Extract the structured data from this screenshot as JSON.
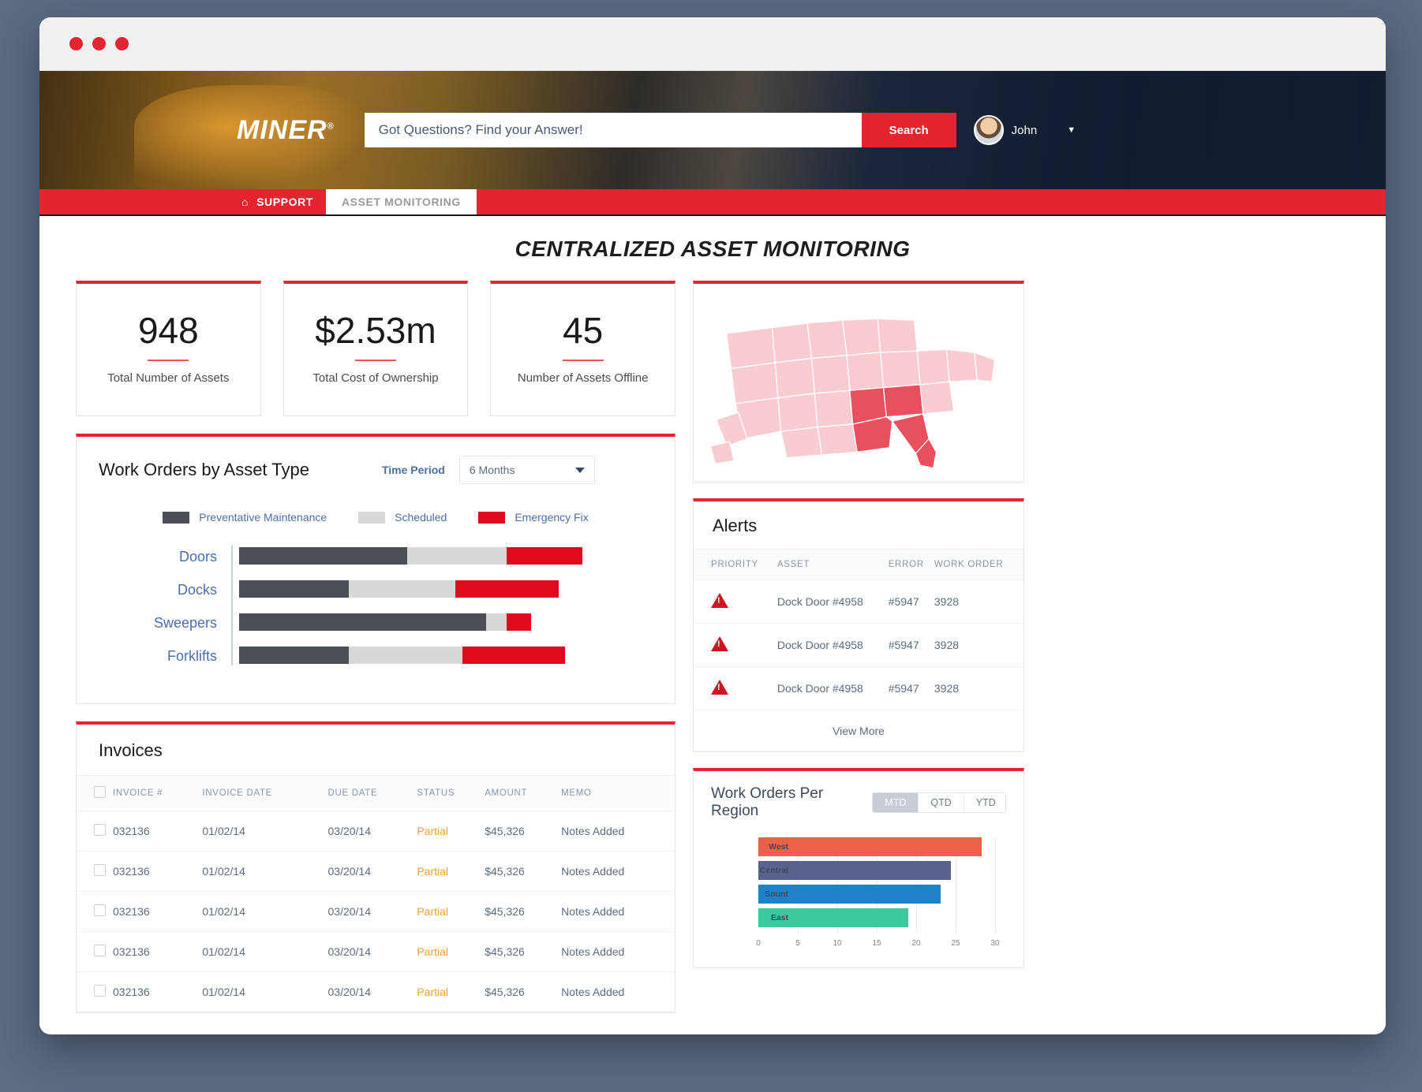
{
  "header": {
    "logo": "MINER",
    "search": {
      "placeholder": "Got Questions? Find your Answer!",
      "value": "",
      "button": "Search"
    },
    "user": {
      "name": "John"
    }
  },
  "nav": {
    "support": "SUPPORT",
    "active_tab": "ASSET MONITORING"
  },
  "page": {
    "title": "CENTRALIZED ASSET MONITORING"
  },
  "kpis": [
    {
      "value": "948",
      "label": "Total Number of Assets"
    },
    {
      "value": "$2.53m",
      "label": "Total Cost of Ownership"
    },
    {
      "value": "45",
      "label": "Number of Assets Offline"
    }
  ],
  "work_orders": {
    "title": "Work Orders by Asset Type",
    "time_period_label": "Time Period",
    "time_period_value": "6 Months",
    "legend": [
      {
        "label": "Preventative Maintenance",
        "color": "#4a4f57"
      },
      {
        "label": "Scheduled",
        "color": "#d8d8d8"
      },
      {
        "label": "Emergency Fix",
        "color": "#e00a1e"
      }
    ]
  },
  "invoices": {
    "title": "Invoices",
    "columns": [
      "INVOICE #",
      "INVOICE DATE",
      "DUE DATE",
      "STATUS",
      "AMOUNT",
      "MEMO"
    ],
    "rows": [
      {
        "invoice": "032136",
        "invoice_date": "01/02/14",
        "due_date": "03/20/14",
        "status": "Partial",
        "amount": "$45,326",
        "memo": "Notes Added"
      },
      {
        "invoice": "032136",
        "invoice_date": "01/02/14",
        "due_date": "03/20/14",
        "status": "Partial",
        "amount": "$45,326",
        "memo": "Notes Added"
      },
      {
        "invoice": "032136",
        "invoice_date": "01/02/14",
        "due_date": "03/20/14",
        "status": "Partial",
        "amount": "$45,326",
        "memo": "Notes Added"
      },
      {
        "invoice": "032136",
        "invoice_date": "01/02/14",
        "due_date": "03/20/14",
        "status": "Partial",
        "amount": "$45,326",
        "memo": "Notes Added"
      },
      {
        "invoice": "032136",
        "invoice_date": "01/02/14",
        "due_date": "03/20/14",
        "status": "Partial",
        "amount": "$45,326",
        "memo": "Notes Added"
      }
    ]
  },
  "alerts": {
    "title": "Alerts",
    "columns": [
      "PRIORITY",
      "ASSET",
      "ERROR",
      "WORK ORDER"
    ],
    "rows": [
      {
        "priority": "warning-icon",
        "asset": "Dock Door #4958",
        "error": "#5947",
        "work_order": "3928"
      },
      {
        "priority": "warning-icon",
        "asset": "Dock Door #4958",
        "error": "#5947",
        "work_order": "3928"
      },
      {
        "priority": "warning-icon",
        "asset": "Dock Door #4958",
        "error": "#5947",
        "work_order": "3928"
      }
    ],
    "view_more": "View More"
  },
  "region": {
    "title": "Work Orders Per Region",
    "toggles": [
      {
        "label": "MTD",
        "active": true
      },
      {
        "label": "QTD",
        "active": false
      },
      {
        "label": "YTD",
        "active": false
      }
    ]
  },
  "chart_data": [
    {
      "type": "bar",
      "title": "Work Orders by Asset Type",
      "orientation": "horizontal",
      "stacked": true,
      "categories": [
        "Doors",
        "Docks",
        "Sweepers",
        "Forklifts"
      ],
      "series": [
        {
          "name": "Preventative Maintenance",
          "color": "#4a4f57",
          "values": [
            49,
            32,
            72,
            32
          ]
        },
        {
          "name": "Scheduled",
          "color": "#d8d8d8",
          "values": [
            29,
            31,
            6,
            33
          ]
        },
        {
          "name": "Emergency Fix",
          "color": "#e00a1e",
          "values": [
            22,
            30,
            7,
            30
          ]
        }
      ],
      "xlabel": "",
      "ylabel": "",
      "grid": false,
      "legend_position": "top"
    },
    {
      "type": "bar",
      "title": "Work Orders Per Region",
      "orientation": "horizontal",
      "categories": [
        "West",
        "Central",
        "Sount",
        "East"
      ],
      "values": [
        28.3,
        24.4,
        23.1,
        19.0
      ],
      "colors": [
        "#ec6247",
        "#59628c",
        "#1f82c8",
        "#3bc9a0"
      ],
      "xticks": [
        "0",
        "5",
        "10",
        "15",
        "20",
        "25",
        "30"
      ],
      "xlim": [
        0,
        30
      ],
      "grid": true,
      "legend_position": "none"
    }
  ],
  "map": {
    "name": "usa-map",
    "base_color": "#f8cfd4",
    "highlight_color": "#e8505f"
  }
}
